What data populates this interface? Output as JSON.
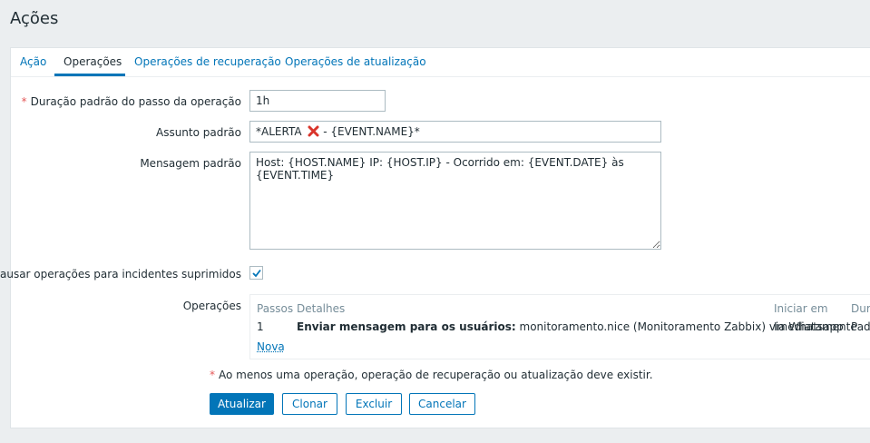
{
  "page": {
    "title": "Ações"
  },
  "tabs": [
    {
      "label": "Ação",
      "active": false
    },
    {
      "label": "Operações",
      "active": true
    },
    {
      "label": "Operações de recuperação",
      "active": false
    },
    {
      "label": "Operações de atualização",
      "active": false
    }
  ],
  "form": {
    "step_duration": {
      "label": "Duração padrão do passo da operação",
      "required_mark": "*",
      "value": "1h"
    },
    "subject": {
      "label": "Assunto padrão",
      "value_prefix": "*ALERTA",
      "value_icon": "red-x-icon",
      "value_suffix": " - {EVENT.NAME}*"
    },
    "message": {
      "label": "Mensagem padrão",
      "value": "Host: {HOST.NAME} IP: {HOST.IP} - Ocorrido em: {EVENT.DATE} às\n{EVENT.TIME}"
    },
    "pause_suppressed": {
      "label": "Pausar operações para incidentes suprimidos",
      "checked": true
    },
    "operations": {
      "label": "Operações",
      "headers": {
        "steps": "Passos",
        "details": "Detalhes",
        "start_in": "Iniciar em",
        "duration": "Dura"
      },
      "rows": [
        {
          "step": "1",
          "details_bold": "Enviar mensagem para os usuários:",
          "details_rest": " monitoramento.nice (Monitoramento Zabbix) via Whatsapp",
          "start_in": "Imediatamente",
          "duration": "Pad"
        }
      ],
      "new_link": "Nova"
    },
    "note": {
      "required_mark": "*",
      "text": "Ao menos uma operação, operação de recuperação ou atualização deve existir."
    }
  },
  "buttons": {
    "update": "Atualizar",
    "clone": "Clonar",
    "delete": "Excluir",
    "cancel": "Cancelar"
  },
  "colors": {
    "accent": "#0275b8",
    "required": "#e45959",
    "background": "#ebeef0",
    "error_icon": "#d9352b"
  }
}
